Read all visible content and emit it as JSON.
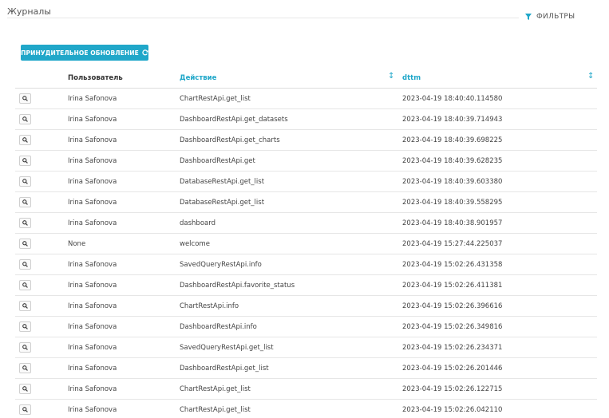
{
  "page": {
    "title": "Журналы"
  },
  "filters": {
    "label": "ФИЛЬТРЫ",
    "icon": "filter-icon"
  },
  "toolbar": {
    "refresh_label": "ПРИНУДИТЕЛЬНОЕ ОБНОВЛЕНИЕ",
    "refresh_icon": "refresh-icon"
  },
  "table": {
    "columns": {
      "user": "Пользователь",
      "action": "Действие",
      "dttm": "dttm"
    },
    "sort_icon": "↕",
    "rows": [
      {
        "user": "Irina Safonova",
        "action": "ChartRestApi.get_list",
        "dttm": "2023-04-19 18:40:40.114580"
      },
      {
        "user": "Irina Safonova",
        "action": "DashboardRestApi.get_datasets",
        "dttm": "2023-04-19 18:40:39.714943"
      },
      {
        "user": "Irina Safonova",
        "action": "DashboardRestApi.get_charts",
        "dttm": "2023-04-19 18:40:39.698225"
      },
      {
        "user": "Irina Safonova",
        "action": "DashboardRestApi.get",
        "dttm": "2023-04-19 18:40:39.628235"
      },
      {
        "user": "Irina Safonova",
        "action": "DatabaseRestApi.get_list",
        "dttm": "2023-04-19 18:40:39.603380"
      },
      {
        "user": "Irina Safonova",
        "action": "DatabaseRestApi.get_list",
        "dttm": "2023-04-19 18:40:39.558295"
      },
      {
        "user": "Irina Safonova",
        "action": "dashboard",
        "dttm": "2023-04-19 18:40:38.901957"
      },
      {
        "user": "None",
        "action": "welcome",
        "dttm": "2023-04-19 15:27:44.225037"
      },
      {
        "user": "Irina Safonova",
        "action": "SavedQueryRestApi.info",
        "dttm": "2023-04-19 15:02:26.431358"
      },
      {
        "user": "Irina Safonova",
        "action": "DashboardRestApi.favorite_status",
        "dttm": "2023-04-19 15:02:26.411381"
      },
      {
        "user": "Irina Safonova",
        "action": "ChartRestApi.info",
        "dttm": "2023-04-19 15:02:26.396616"
      },
      {
        "user": "Irina Safonova",
        "action": "DashboardRestApi.info",
        "dttm": "2023-04-19 15:02:26.349816"
      },
      {
        "user": "Irina Safonova",
        "action": "SavedQueryRestApi.get_list",
        "dttm": "2023-04-19 15:02:26.234371"
      },
      {
        "user": "Irina Safonova",
        "action": "DashboardRestApi.get_list",
        "dttm": "2023-04-19 15:02:26.201446"
      },
      {
        "user": "Irina Safonova",
        "action": "ChartRestApi.get_list",
        "dttm": "2023-04-19 15:02:26.122715"
      },
      {
        "user": "Irina Safonova",
        "action": "ChartRestApi.get_list",
        "dttm": "2023-04-19 15:02:26.042110"
      }
    ]
  },
  "colors": {
    "accent": "#20a7c9",
    "row_border": "#e6e6e6"
  }
}
